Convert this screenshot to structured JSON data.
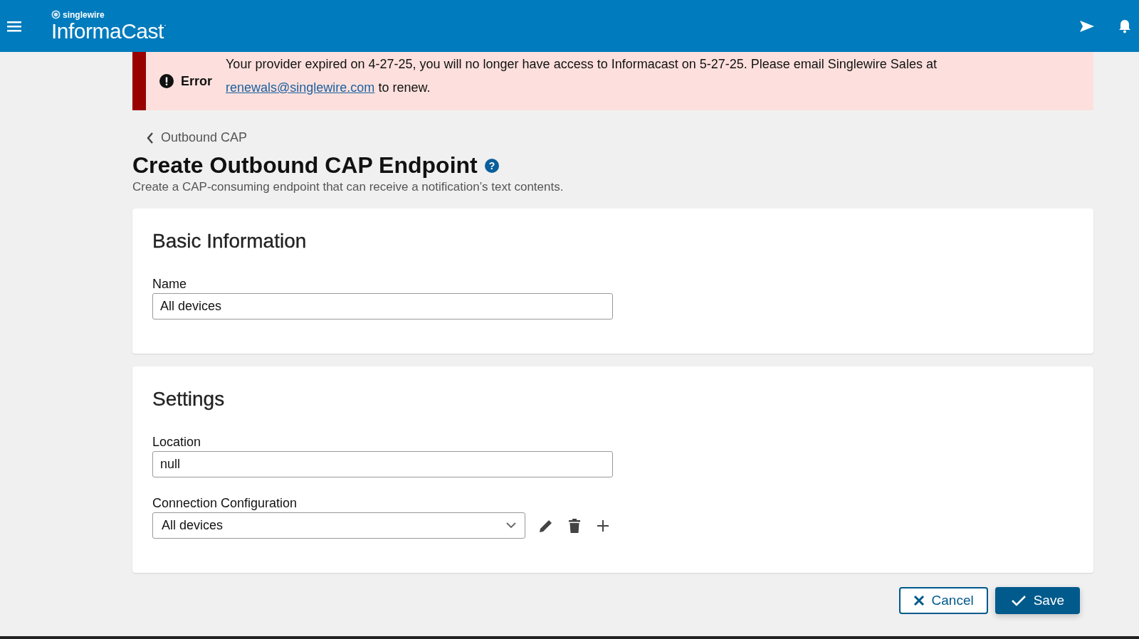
{
  "header": {
    "brand_small": "singlewire",
    "brand": "InformaCast",
    "brand_mark": "·"
  },
  "banner": {
    "label": "Error",
    "message_before": "Your provider expired on 4-27-25, you will no longer have access to Informacast on 5-27-25. Please email Singlewire Sales at ",
    "link": "renewals@singlewire.com",
    "message_after": " to renew."
  },
  "breadcrumb": "Outbound CAP",
  "title": "Create Outbound CAP Endpoint",
  "help_glyph": "?",
  "subtitle": "Create a CAP-consuming endpoint that can receive a notification’s text contents.",
  "sections": [
    {
      "title": "Basic Information",
      "fields": [
        {
          "kind": "text",
          "label": "Name",
          "value": "All devices"
        }
      ]
    },
    {
      "title": "Settings",
      "fields": [
        {
          "kind": "text",
          "label": "Location",
          "value": "null"
        },
        {
          "kind": "select",
          "label": "Connection Configuration",
          "value": "All devices"
        }
      ]
    }
  ],
  "buttons": [
    {
      "kind": "cancel",
      "label": "Cancel"
    },
    {
      "kind": "save",
      "label": "Save"
    }
  ]
}
